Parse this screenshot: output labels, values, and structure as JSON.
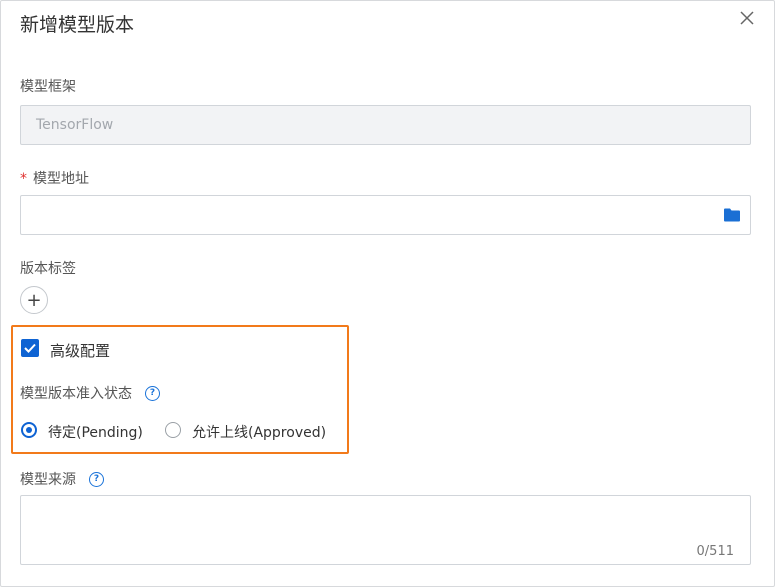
{
  "dialog": {
    "title": "新增模型版本"
  },
  "framework": {
    "label": "模型框架",
    "value": "TensorFlow"
  },
  "model_address": {
    "required_mark": "*",
    "label": "模型地址",
    "value": ""
  },
  "version_tags": {
    "label": "版本标签",
    "add_symbol": "+"
  },
  "advanced": {
    "label": "高级配置",
    "checked": true
  },
  "admission_status": {
    "label": "模型版本准入状态",
    "help_symbol": "?",
    "options": [
      {
        "label": "待定(Pending)",
        "selected": true
      },
      {
        "label": "允许上线(Approved)",
        "selected": false
      }
    ]
  },
  "model_source": {
    "label": "模型来源",
    "help_symbol": "?",
    "counter": "0/511"
  },
  "colors": {
    "primary": "#0e63d3",
    "highlight_border": "#f27a1a",
    "required": "#e0312f",
    "disabled_bg": "#f2f3f5"
  }
}
